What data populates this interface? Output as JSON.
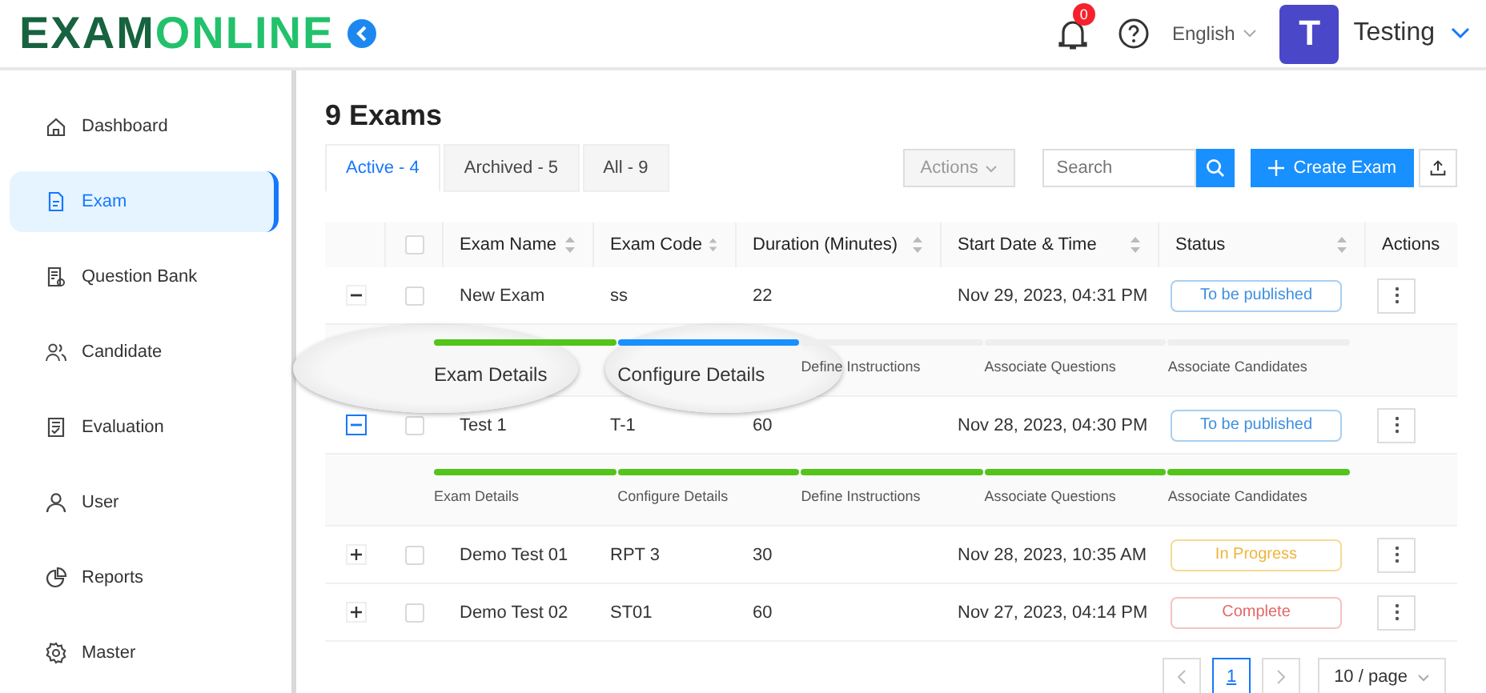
{
  "header": {
    "logo": {
      "primary": "EXAM",
      "secondary": "ONLINE"
    },
    "notifications": {
      "count": "0"
    },
    "language": "English",
    "user": {
      "initial": "T",
      "name": "Testing"
    }
  },
  "sidebar": {
    "items": [
      {
        "label": "Dashboard",
        "selected": false
      },
      {
        "label": "Exam",
        "selected": true
      },
      {
        "label": "Question Bank",
        "selected": false
      },
      {
        "label": "Candidate",
        "selected": false
      },
      {
        "label": "Evaluation",
        "selected": false
      },
      {
        "label": "User",
        "selected": false
      },
      {
        "label": "Reports",
        "selected": false
      },
      {
        "label": "Master",
        "selected": false
      }
    ]
  },
  "page": {
    "title": "9 Exams",
    "tabs": [
      {
        "label": "Active - 4",
        "selected": true
      },
      {
        "label": "Archived - 5",
        "selected": false
      },
      {
        "label": "All - 9",
        "selected": false
      }
    ],
    "actions_button": {
      "label": "Actions",
      "disabled": true
    },
    "search": {
      "placeholder": "Search"
    },
    "create_button": "Create Exam"
  },
  "table": {
    "select_all": {
      "checked": false
    },
    "columns": [
      "Exam Name",
      "Exam Code",
      "Duration (Minutes)",
      "Start Date & Time",
      "Status",
      "Actions"
    ],
    "rows": [
      {
        "expanded": true,
        "checked": false,
        "name": "New Exam",
        "code": "ss",
        "duration": "22",
        "start": "Nov 29, 2023, 04:31 PM",
        "status": {
          "label": "To be published",
          "kind": "pending"
        },
        "steps": [
          {
            "label": "Exam Details",
            "completed": true,
            "current": false,
            "magnified": true
          },
          {
            "label": "Configure Details",
            "completed": false,
            "current": true,
            "magnified": true
          },
          {
            "label": "Define Instructions",
            "completed": false,
            "current": false,
            "magnified": false
          },
          {
            "label": "Associate Questions",
            "completed": false,
            "current": false,
            "magnified": false
          },
          {
            "label": "Associate Candidates",
            "completed": false,
            "current": false,
            "magnified": false
          }
        ]
      },
      {
        "expanded": true,
        "checked": false,
        "name": "Test 1",
        "code": "T-1",
        "duration": "60",
        "start": "Nov 28, 2023, 04:30 PM",
        "status": {
          "label": "To be published",
          "kind": "pending"
        },
        "steps": [
          {
            "label": "Exam Details",
            "completed": true,
            "current": false,
            "magnified": false
          },
          {
            "label": "Configure Details",
            "completed": true,
            "current": false,
            "magnified": false
          },
          {
            "label": "Define Instructions",
            "completed": true,
            "current": false,
            "magnified": false
          },
          {
            "label": "Associate Questions",
            "completed": true,
            "current": false,
            "magnified": false
          },
          {
            "label": "Associate Candidates",
            "completed": true,
            "current": false,
            "magnified": false
          }
        ]
      },
      {
        "expanded": false,
        "checked": false,
        "name": "Demo Test 01",
        "code": "RPT 3",
        "duration": "30",
        "start": "Nov 28, 2023, 10:35 AM",
        "status": {
          "label": "In Progress",
          "kind": "progress"
        }
      },
      {
        "expanded": false,
        "checked": false,
        "name": "Demo Test 02",
        "code": "ST01",
        "duration": "60",
        "start": "Nov 27, 2023, 04:14 PM",
        "status": {
          "label": "Complete",
          "kind": "complete"
        }
      }
    ]
  },
  "pagination": {
    "pages": [
      {
        "label": "1",
        "selected": true
      }
    ],
    "page_size": "10 / page"
  }
}
